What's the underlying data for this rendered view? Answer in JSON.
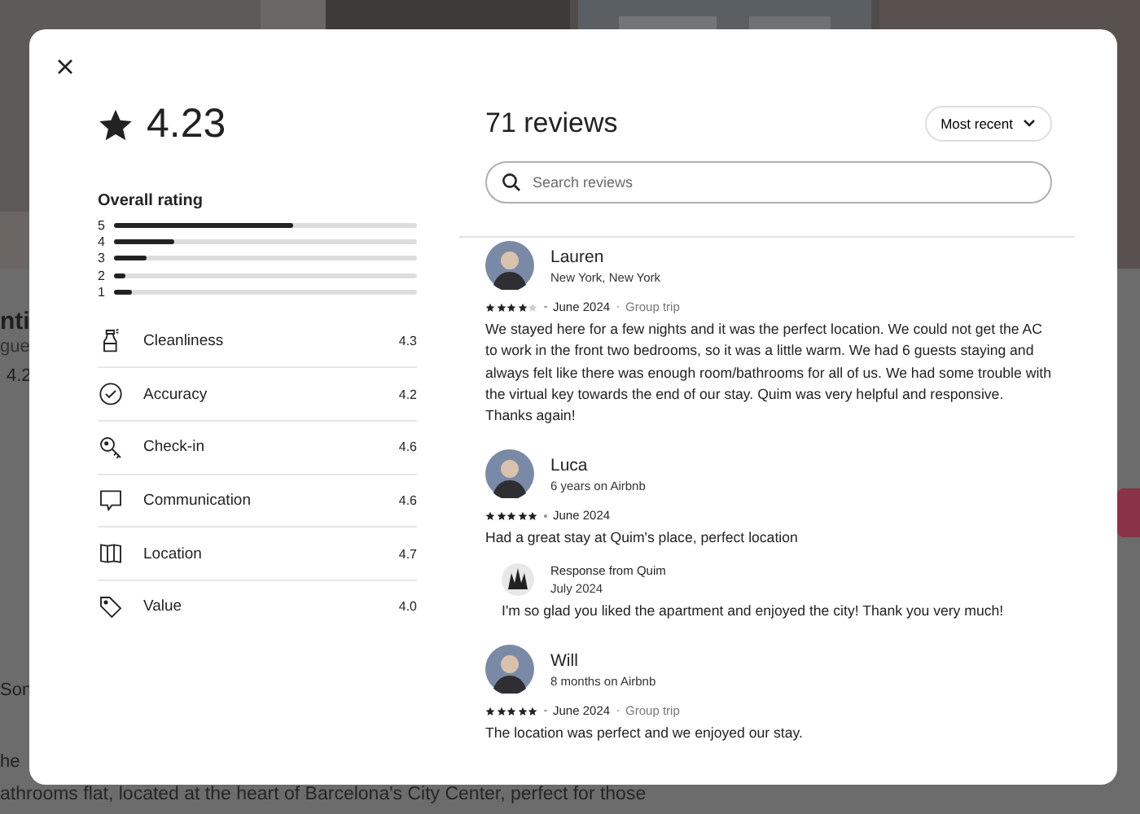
{
  "background": {
    "fragments": [
      "nti",
      "gue",
      "4.2",
      "Son",
      "he"
    ],
    "description_line": "athrooms flat, located at the heart of Barcelona's City Center, perfect for those"
  },
  "rating": {
    "score": "4.23",
    "overall_label": "Overall rating",
    "distribution": [
      {
        "label": "5",
        "level": 0.59
      },
      {
        "label": "4",
        "level": 0.2
      },
      {
        "label": "3",
        "level": 0.11
      },
      {
        "label": "2",
        "level": 0.04
      },
      {
        "label": "1",
        "level": 0.06
      }
    ],
    "categories": [
      {
        "kind": "cleanliness",
        "label": "Cleanliness",
        "value": "4.3"
      },
      {
        "kind": "accuracy",
        "label": "Accuracy",
        "value": "4.2"
      },
      {
        "kind": "checkin",
        "label": "Check-in",
        "value": "4.6"
      },
      {
        "kind": "communication",
        "label": "Communication",
        "value": "4.6"
      },
      {
        "kind": "location",
        "label": "Location",
        "value": "4.7"
      },
      {
        "kind": "value",
        "label": "Value",
        "value": "4.0"
      }
    ]
  },
  "reviews_header": {
    "title": "71 reviews",
    "sort": "Most recent",
    "search": {
      "placeholder": "Search reviews"
    }
  },
  "reviews": [
    {
      "name": "Lauren",
      "subtitle": "New York, New York",
      "stars": 4,
      "date": "June 2024",
      "trip": "Group trip",
      "text": "We stayed here for a few nights and it was the perfect location. We could not get the AC to work in the front two bedrooms, so it was a little warm. We had 6 guests staying and always felt like there was enough room/bathrooms for all of us. We had some trouble with the virtual key towards the end of our stay. Quim was very helpful and responsive. Thanks again!"
    },
    {
      "name": "Luca",
      "subtitle": "6 years on Airbnb",
      "stars": 5,
      "date": "June 2024",
      "text": "Had a great stay at Quim's place, perfect location",
      "response": {
        "title": "Response from Quim",
        "date": "July 2024",
        "text": "I'm so glad you liked the apartment and enjoyed the city! Thank you very much!"
      }
    },
    {
      "name": "Will",
      "subtitle": "8 months on Airbnb",
      "stars": 5,
      "date": "June 2024",
      "trip": "Group trip",
      "text": "The location was perfect and we enjoyed our stay."
    }
  ]
}
